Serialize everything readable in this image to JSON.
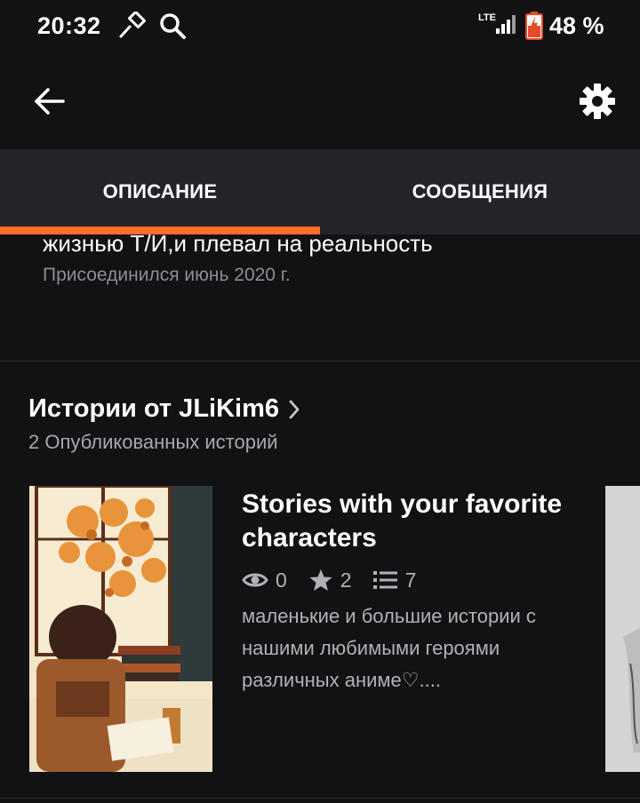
{
  "status_bar": {
    "time": "20:32",
    "network": "LTE",
    "battery": "48 %",
    "icons": [
      "hammer-icon",
      "search-icon",
      "signal-icon",
      "battery-icon"
    ]
  },
  "app_bar": {
    "back_icon": "arrow-left-icon",
    "settings_icon": "gear-icon"
  },
  "tabs": [
    {
      "label": "ОПИСАНИЕ",
      "active": true
    },
    {
      "label": "СООБЩЕНИЯ",
      "active": false
    }
  ],
  "about": {
    "text_fragment": "жизнью Т/И,и плевал на реальность",
    "joined": "Присоединился июнь 2020 г."
  },
  "stories": {
    "title": "Истории от JLiKim6",
    "subtitle": "2 Опубликованных историй",
    "items": [
      {
        "title": "Stories with your favorite characters",
        "views": "0",
        "votes": "2",
        "parts": "7",
        "description": "маленькие и большие истории с нашими любимыми героями различных аниме♡...."
      }
    ]
  },
  "colors": {
    "background": "#121114",
    "tab_bar": "#242327",
    "accent": "#ff6c2c",
    "muted_text": "#8e8c93"
  }
}
